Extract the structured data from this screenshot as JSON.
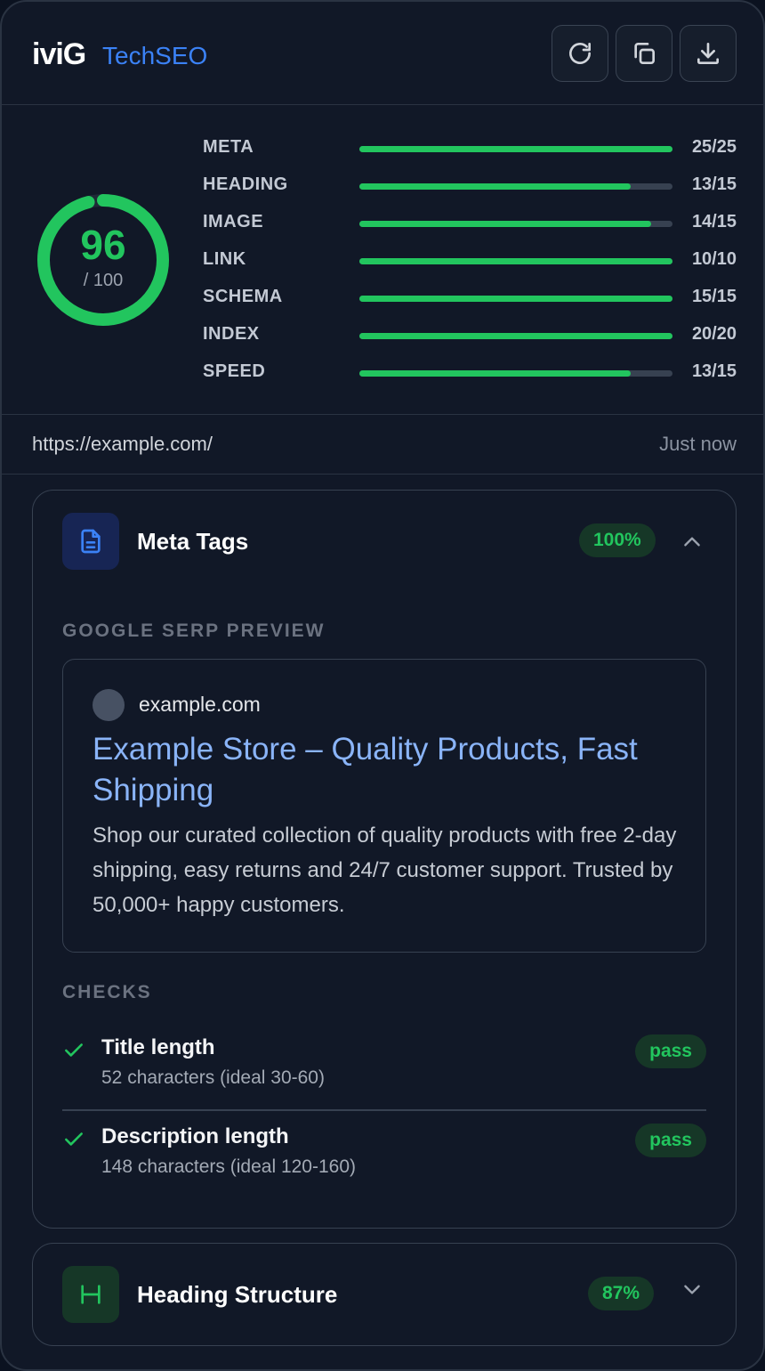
{
  "header": {
    "brand": "iviG",
    "product": "TechSEO",
    "buttons": [
      {
        "name": "refresh",
        "icon": "refresh-icon"
      },
      {
        "name": "copy",
        "icon": "copy-icon"
      },
      {
        "name": "download",
        "icon": "download-icon"
      }
    ]
  },
  "score": {
    "value": "96",
    "max": "/ 100",
    "fraction": 0.96,
    "color": "#22c55e",
    "categories": [
      {
        "label": "META",
        "score": "25/25",
        "fraction": 1.0
      },
      {
        "label": "HEADING",
        "score": "13/15",
        "fraction": 0.867
      },
      {
        "label": "IMAGE",
        "score": "14/15",
        "fraction": 0.933
      },
      {
        "label": "LINK",
        "score": "10/10",
        "fraction": 1.0
      },
      {
        "label": "SCHEMA",
        "score": "15/15",
        "fraction": 1.0
      },
      {
        "label": "INDEX",
        "score": "20/20",
        "fraction": 1.0
      },
      {
        "label": "SPEED",
        "score": "13/15",
        "fraction": 0.867
      }
    ]
  },
  "page": {
    "url": "https://example.com/",
    "analyzed": "Just now"
  },
  "meta_tags": {
    "title": "Meta Tags",
    "percent": "100%",
    "icon": "document-icon",
    "serp_label": "GOOGLE SERP PREVIEW",
    "serp": {
      "domain": "example.com",
      "title": "Example Store – Quality Products, Fast Shipping",
      "description": "Shop our curated collection of quality products with free 2-day shipping, easy returns and 24/7 customer support. Trusted by 50,000+ happy customers."
    },
    "checks_label": "CHECKS",
    "checks": [
      {
        "title": "Title length",
        "detail": "52 characters (ideal 30-60)",
        "status": "pass"
      },
      {
        "title": "Description length",
        "detail": "148 characters (ideal 120-160)",
        "status": "pass"
      }
    ]
  },
  "heading_structure": {
    "title": "Heading Structure",
    "percent": "87%",
    "icon": "heading-icon"
  },
  "colors": {
    "accent_blue": "#3b82f6",
    "success": "#22c55e",
    "serp_link": "#8ab4f8"
  }
}
